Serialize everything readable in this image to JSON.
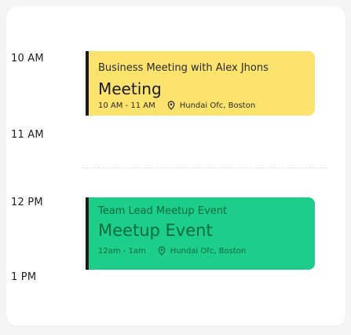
{
  "schedule": {
    "time_slots": [
      {
        "label": "10 AM"
      },
      {
        "label": "11 AM"
      },
      {
        "label": "12 PM"
      },
      {
        "label": "1 PM"
      }
    ],
    "events": [
      {
        "subtitle": "Business Meeting with Alex Jhons",
        "title": "Meeting",
        "time": "10 AM - 11 AM",
        "location": "Hundai Ofc, Boston",
        "location_icon": "location-pin-icon",
        "color": "#fbe36e",
        "accent": "#1a1a1a"
      },
      {
        "subtitle": "Team Lead Meetup Event",
        "title": "Meetup Event",
        "time": "12am - 1am",
        "location": "Hundai Ofc, Boston",
        "location_icon": "location-pin-icon",
        "color": "#1dcd8a",
        "accent": "#1a1a1a"
      }
    ]
  }
}
